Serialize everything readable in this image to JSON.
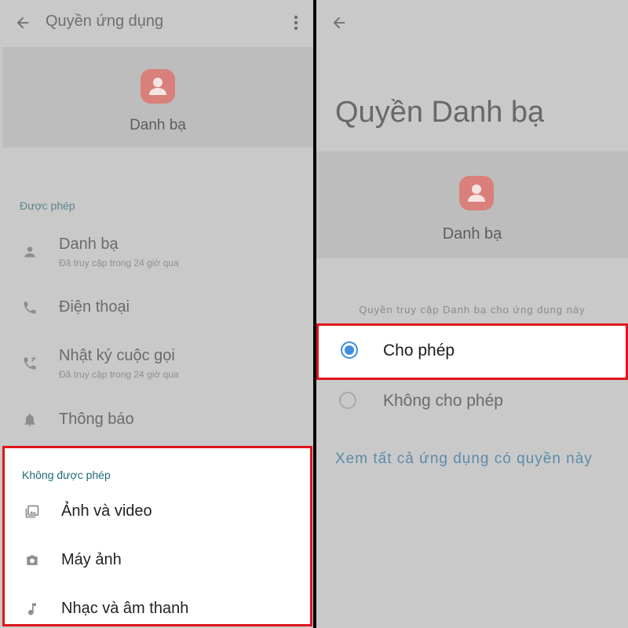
{
  "left": {
    "header": {
      "title": "Quyền ứng dụng"
    },
    "app": {
      "name": "Danh bạ"
    },
    "allowed": {
      "label": "Được phép",
      "items": [
        {
          "label": "Danh bạ",
          "sub": "Đã truy cập trong 24 giờ qua",
          "icon": "person-icon"
        },
        {
          "label": "Điện thoại",
          "sub": "",
          "icon": "phone-icon"
        },
        {
          "label": "Nhật ký cuộc gọi",
          "sub": "Đã truy cập trong 24 giờ qua",
          "icon": "call-log-icon"
        },
        {
          "label": "Thông báo",
          "sub": "",
          "icon": "bell-icon"
        }
      ]
    },
    "denied": {
      "label": "Không được phép",
      "items": [
        {
          "label": "Ảnh và video",
          "icon": "photo-video-icon"
        },
        {
          "label": "Máy ảnh",
          "icon": "camera-icon"
        },
        {
          "label": "Nhạc và âm thanh",
          "icon": "music-note-icon"
        }
      ]
    }
  },
  "right": {
    "title": "Quyền Danh bạ",
    "app": {
      "name": "Danh bạ"
    },
    "subtitle": "Quyền truy cập Danh bạ cho ứng dụng này",
    "options": {
      "allow": {
        "label": "Cho phép",
        "selected": true
      },
      "deny": {
        "label": "Không cho phép",
        "selected": false
      }
    },
    "see_all": "Xem tất cả ứng dụng có quyền này"
  },
  "colors": {
    "highlight_border": "#e0161c",
    "radio_selected": "#3f8ee0",
    "link": "#5c8ba9",
    "section_label": "#5b878c",
    "app_icon_bg": "#d9807a"
  }
}
